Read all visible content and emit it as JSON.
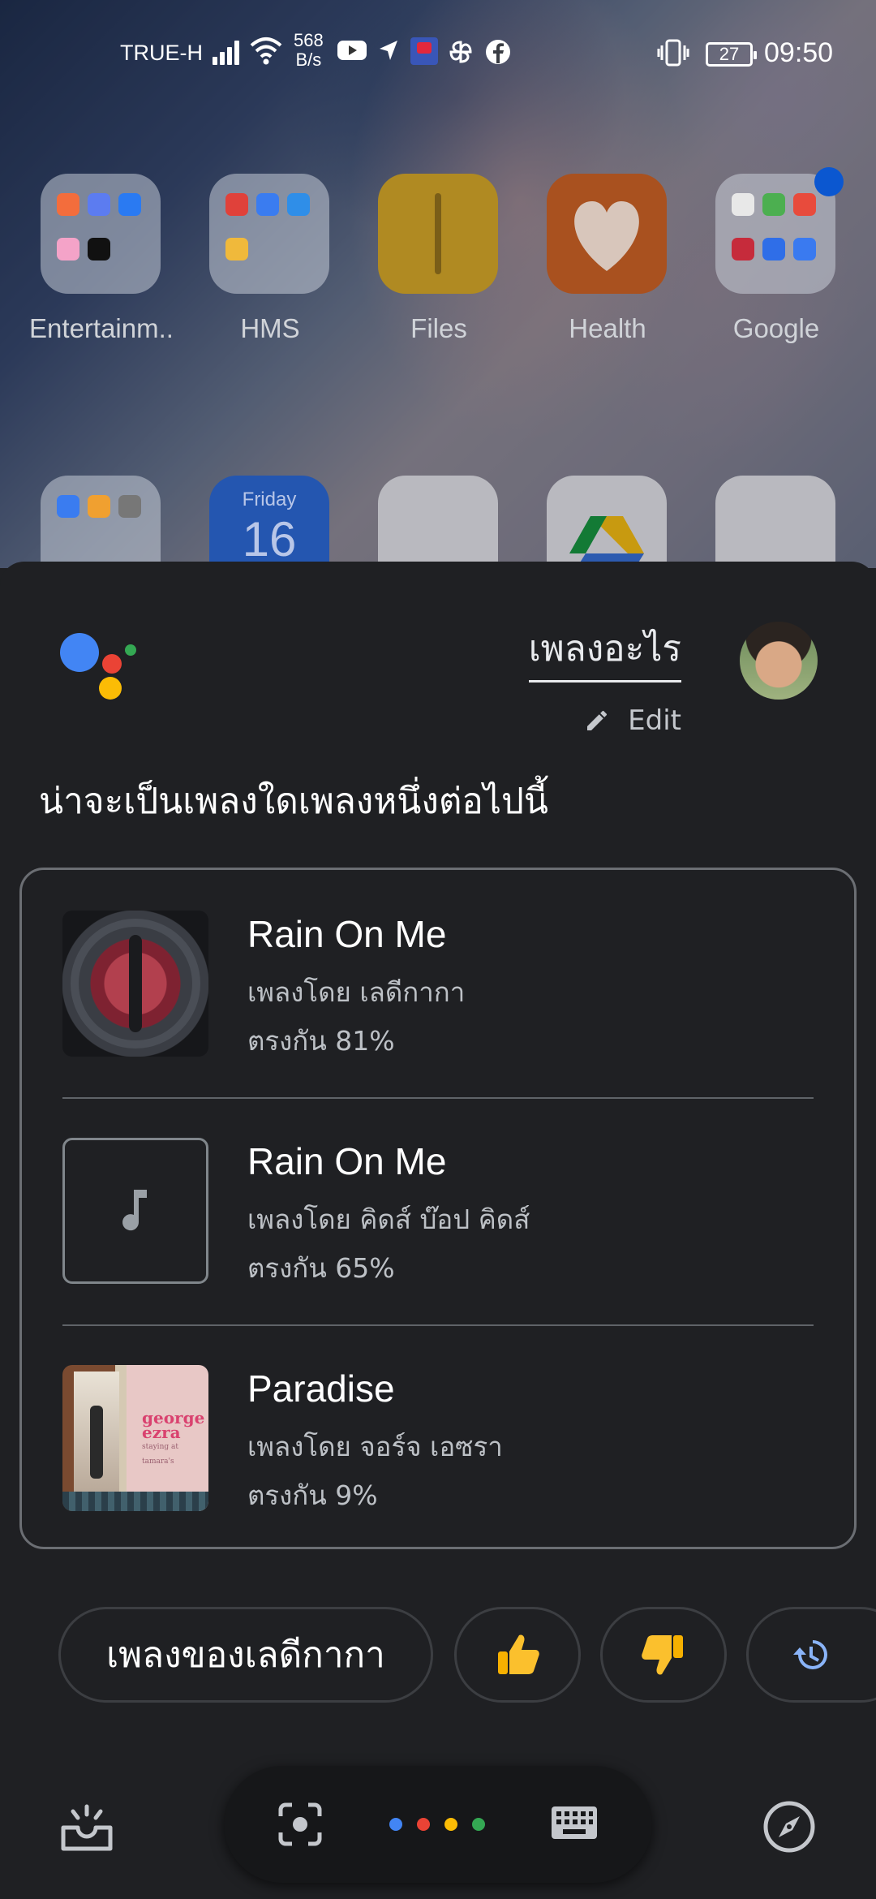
{
  "status_bar": {
    "carrier": "TRUE-H",
    "net_speed_value": "568",
    "net_speed_unit": "B/s",
    "battery": "27",
    "time": "09:50"
  },
  "home": {
    "apps": [
      {
        "label": "Entertainm.."
      },
      {
        "label": "HMS"
      },
      {
        "label": "Files"
      },
      {
        "label": "Health"
      },
      {
        "label": "Google"
      }
    ],
    "calendar_day": "Friday",
    "calendar_date": "16"
  },
  "assistant": {
    "query": "เพลงอะไร",
    "edit_label": "Edit",
    "subtitle": "น่าจะเป็นเพลงใดเพลงหนึ่งต่อไปนี้",
    "results": [
      {
        "title": "Rain On Me",
        "artist": "เพลงโดย เลดีกากา",
        "match": "ตรงกัน 81%",
        "art": "album-art"
      },
      {
        "title": "Rain On Me",
        "artist": "เพลงโดย คิดส์ บ๊อป คิดส์",
        "match": "ตรงกัน 65%",
        "art": "music-note-icon"
      },
      {
        "title": "Paradise",
        "artist": "เพลงโดย จอร์จ เอซรา",
        "match": "ตรงกัน 9%",
        "art": "album-art"
      }
    ],
    "album_text": "george ezra",
    "album_subtext": "staying at tamara's",
    "suggestion_chip": "เพลงของเลดีกากา",
    "icons": [
      "thumbs-up-icon",
      "thumbs-down-icon",
      "history-icon",
      "updates-icon",
      "lens-icon",
      "keyboard-icon",
      "explore-icon"
    ]
  },
  "colors": {
    "google_blue": "#4285f4",
    "google_red": "#ea4335",
    "google_yellow": "#fbbc05",
    "google_green": "#34a853",
    "sheet_bg": "#1f2023"
  }
}
